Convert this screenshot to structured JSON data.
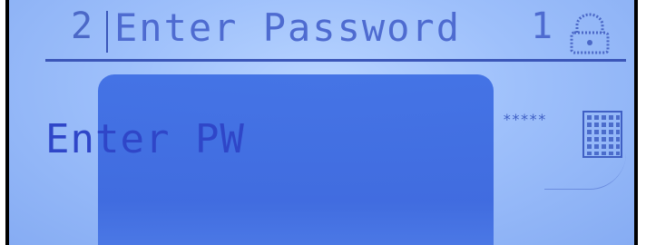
{
  "header": {
    "screen_number": "2",
    "title": "Enter Password",
    "user_level": "1",
    "lock_icon": "lock-icon"
  },
  "main": {
    "prompt": "Enter PW",
    "password_mask": "*****",
    "keypad_icon": "keypad-icon"
  },
  "colors": {
    "background": "#a6c6fd",
    "text": "#3f63c9",
    "shadow_block": "#3f6fe4"
  }
}
